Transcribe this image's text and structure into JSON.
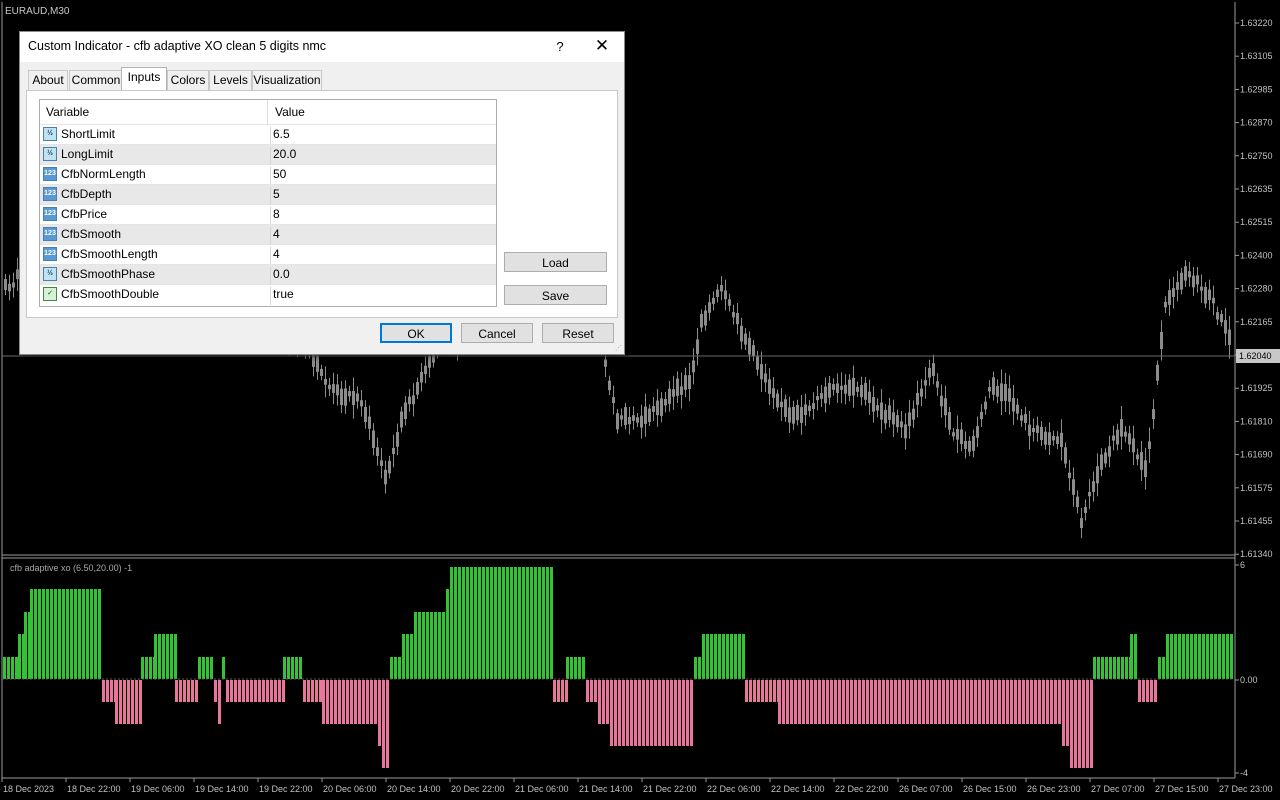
{
  "chart": {
    "symbol_label": "EURAUD,M30",
    "current_price": "1.62040",
    "price_ticks": [
      "1.63220",
      "1.63105",
      "1.62985",
      "1.62870",
      "1.62750",
      "1.62635",
      "1.62515",
      "1.62400",
      "1.62280",
      "1.62165",
      "1.62040",
      "1.61925",
      "1.61810",
      "1.61690",
      "1.61575",
      "1.61455",
      "1.61340"
    ],
    "time_labels": [
      "18 Dec 2023",
      "18 Dec 22:00",
      "19 Dec 06:00",
      "19 Dec 14:00",
      "19 Dec 22:00",
      "20 Dec 06:00",
      "20 Dec 14:00",
      "20 Dec 22:00",
      "21 Dec 06:00",
      "21 Dec 14:00",
      "21 Dec 22:00",
      "22 Dec 06:00",
      "22 Dec 14:00",
      "22 Dec 22:00",
      "26 Dec 07:00",
      "26 Dec 15:00",
      "26 Dec 23:00",
      "27 Dec 07:00",
      "27 Dec 15:00",
      "27 Dec 23:00"
    ],
    "indicator_label": "cfb adaptive xo (6.50,20.00) -1",
    "indicator_ticks": [
      "6",
      "0.00",
      "-4"
    ],
    "colors": {
      "background": "#000000",
      "candle": "#8c8c8c",
      "positive_bar": "#36c236",
      "negative_bar": "#e8759a",
      "grid": "#7a7a7a"
    }
  },
  "dialog": {
    "title": "Custom Indicator - cfb adaptive XO clean 5 digits nmc",
    "help_label": "?",
    "close_label": "✕",
    "tabs": [
      {
        "label": "About"
      },
      {
        "label": "Common"
      },
      {
        "label": "Inputs"
      },
      {
        "label": "Colors"
      },
      {
        "label": "Levels"
      },
      {
        "label": "Visualization"
      }
    ],
    "active_tab": "Inputs",
    "table": {
      "col_variable": "Variable",
      "col_value": "Value",
      "rows": [
        {
          "name": "ShortLimit",
          "value": "6.5",
          "icon": "fraction-icon",
          "icon_text": "½"
        },
        {
          "name": "LongLimit",
          "value": "20.0",
          "icon": "fraction-icon",
          "icon_text": "½"
        },
        {
          "name": "CfbNormLength",
          "value": "50",
          "icon": "integer-icon",
          "icon_text": "123"
        },
        {
          "name": "CfbDepth",
          "value": "5",
          "icon": "integer-icon",
          "icon_text": "123"
        },
        {
          "name": "CfbPrice",
          "value": "8",
          "icon": "integer-icon",
          "icon_text": "123"
        },
        {
          "name": "CfbSmooth",
          "value": "4",
          "icon": "integer-icon",
          "icon_text": "123"
        },
        {
          "name": "CfbSmoothLength",
          "value": "4",
          "icon": "integer-icon",
          "icon_text": "123"
        },
        {
          "name": "CfbSmoothPhase",
          "value": "0.0",
          "icon": "fraction-icon",
          "icon_text": "½"
        },
        {
          "name": "CfbSmoothDouble",
          "value": "true",
          "icon": "boolean-icon",
          "icon_text": "✓"
        }
      ]
    },
    "buttons": {
      "load": "Load",
      "save": "Save",
      "ok": "OK",
      "cancel": "Cancel",
      "reset": "Reset"
    }
  }
}
